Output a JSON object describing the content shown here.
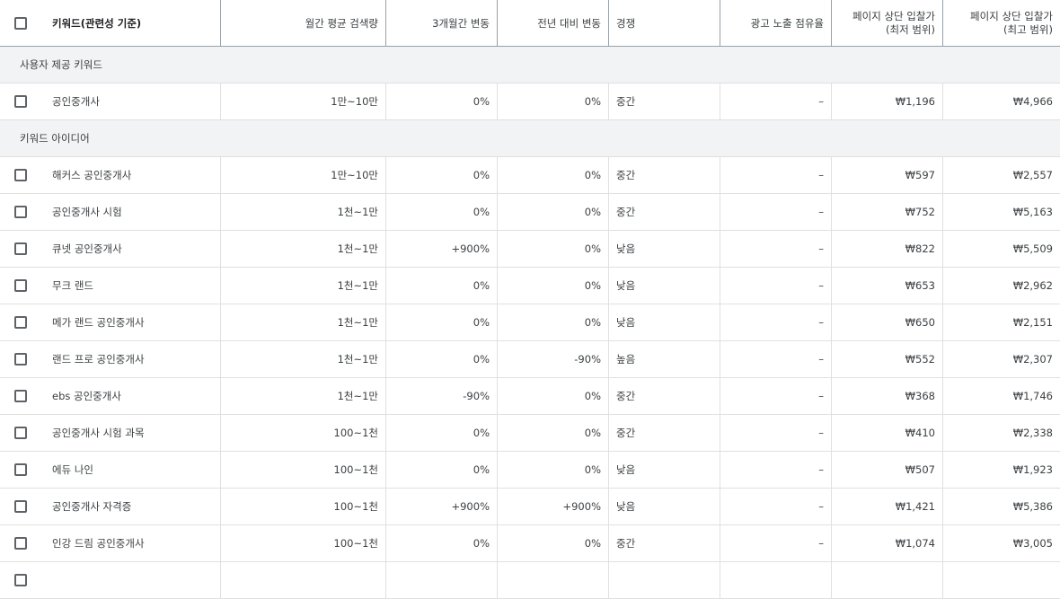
{
  "header": {
    "keyword": "키워드(관련성 기준)",
    "monthly_volume": "월간 평균 검색량",
    "three_month_change": "3개월간 변동",
    "yoy_change": "전년 대비 변동",
    "competition": "경쟁",
    "ad_impression_share": "광고 노출 점유율",
    "top_bid_low_line1": "페이지 상단 입찰가",
    "top_bid_low_line2": "(최저 범위)",
    "top_bid_high_line1": "페이지 상단 입찰가",
    "top_bid_high_line2": "(최고 범위)"
  },
  "groups": {
    "provided_label": "사용자 제공 키워드",
    "ideas_label": "키워드 아이디어"
  },
  "provided_rows": [
    {
      "keyword": "공인중개사",
      "volume": "1만~10만",
      "three_month": "0%",
      "yoy": "0%",
      "competition": "중간",
      "share": "–",
      "low": "₩1,196",
      "high": "₩4,966"
    }
  ],
  "idea_rows": [
    {
      "keyword": "해커스 공인중개사",
      "volume": "1만~10만",
      "three_month": "0%",
      "yoy": "0%",
      "competition": "중간",
      "share": "–",
      "low": "₩597",
      "high": "₩2,557"
    },
    {
      "keyword": "공인중개사 시험",
      "volume": "1천~1만",
      "three_month": "0%",
      "yoy": "0%",
      "competition": "중간",
      "share": "–",
      "low": "₩752",
      "high": "₩5,163"
    },
    {
      "keyword": "큐넷 공인중개사",
      "volume": "1천~1만",
      "three_month": "+900%",
      "yoy": "0%",
      "competition": "낮음",
      "share": "–",
      "low": "₩822",
      "high": "₩5,509"
    },
    {
      "keyword": "무크 랜드",
      "volume": "1천~1만",
      "three_month": "0%",
      "yoy": "0%",
      "competition": "낮음",
      "share": "–",
      "low": "₩653",
      "high": "₩2,962"
    },
    {
      "keyword": "메가 랜드 공인중개사",
      "volume": "1천~1만",
      "three_month": "0%",
      "yoy": "0%",
      "competition": "낮음",
      "share": "–",
      "low": "₩650",
      "high": "₩2,151"
    },
    {
      "keyword": "랜드 프로 공인중개사",
      "volume": "1천~1만",
      "three_month": "0%",
      "yoy": "-90%",
      "competition": "높음",
      "share": "–",
      "low": "₩552",
      "high": "₩2,307"
    },
    {
      "keyword": "ebs 공인중개사",
      "volume": "1천~1만",
      "three_month": "-90%",
      "yoy": "0%",
      "competition": "중간",
      "share": "–",
      "low": "₩368",
      "high": "₩1,746"
    },
    {
      "keyword": "공인중개사 시험 과목",
      "volume": "100~1천",
      "three_month": "0%",
      "yoy": "0%",
      "competition": "중간",
      "share": "–",
      "low": "₩410",
      "high": "₩2,338"
    },
    {
      "keyword": "에듀 나인",
      "volume": "100~1천",
      "three_month": "0%",
      "yoy": "0%",
      "competition": "낮음",
      "share": "–",
      "low": "₩507",
      "high": "₩1,923"
    },
    {
      "keyword": "공인중개사 자격증",
      "volume": "100~1천",
      "three_month": "+900%",
      "yoy": "+900%",
      "competition": "낮음",
      "share": "–",
      "low": "₩1,421",
      "high": "₩5,386"
    },
    {
      "keyword": "인강 드림 공인중개사",
      "volume": "100~1천",
      "three_month": "0%",
      "yoy": "0%",
      "competition": "중간",
      "share": "–",
      "low": "₩1,074",
      "high": "₩3,005"
    },
    {
      "keyword": "",
      "volume": "",
      "three_month": "",
      "yoy": "",
      "competition": "",
      "share": "",
      "low": "",
      "high": ""
    }
  ]
}
